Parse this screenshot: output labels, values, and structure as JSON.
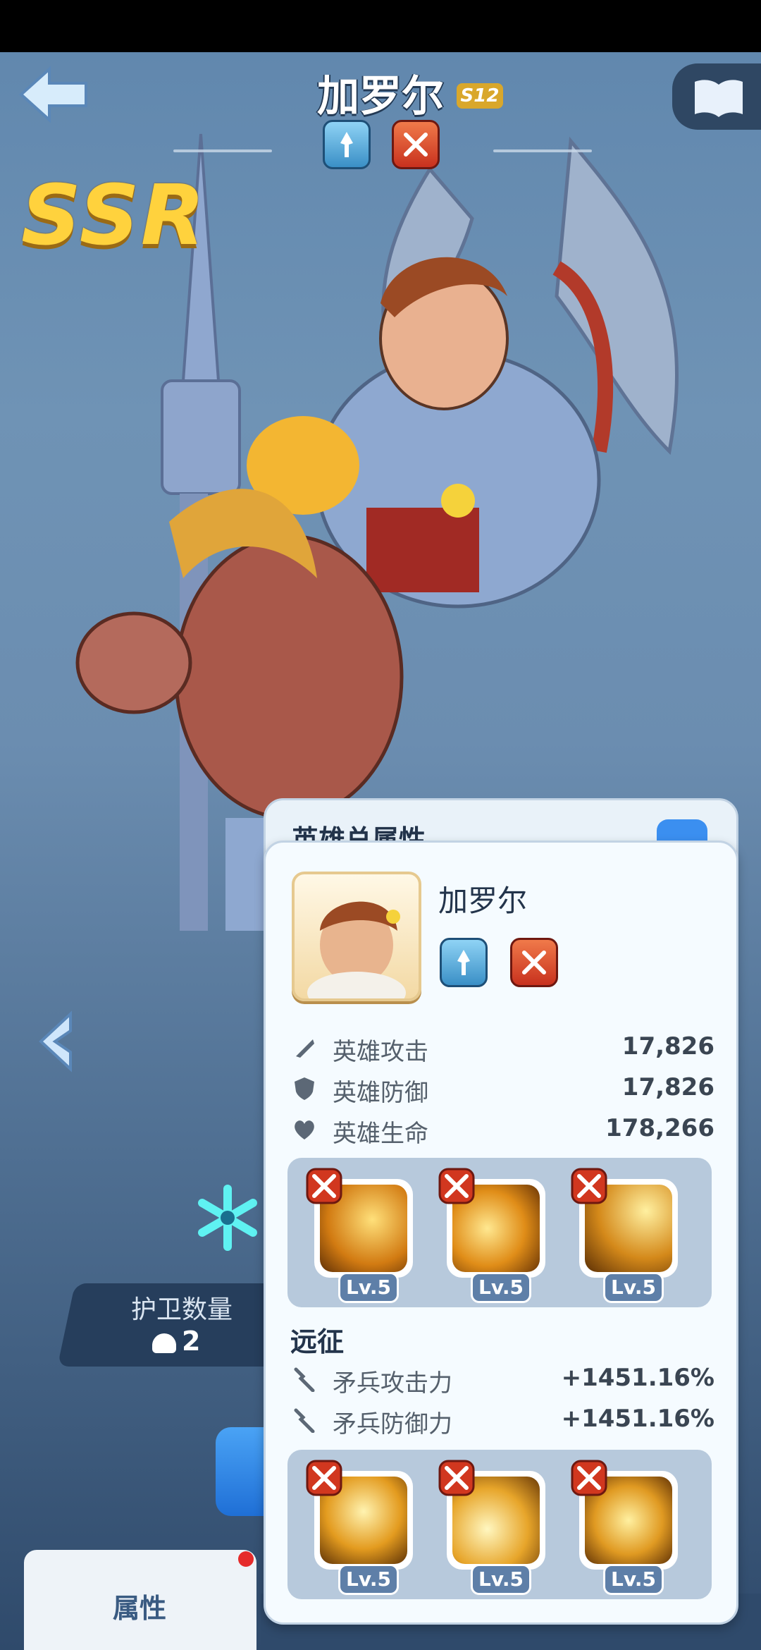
{
  "header": {
    "title": "加罗尔",
    "star_badge": "S12",
    "rarity": "SSR",
    "class_icons": [
      "spear-class-icon",
      "crossed-swords-icon"
    ]
  },
  "guard": {
    "label": "护卫数量",
    "count": "2"
  },
  "bottom_tabs": [
    {
      "label": "属性",
      "active": true,
      "has_notification": true
    }
  ],
  "panel": {
    "back_title": "英雄总属性",
    "hero_name": "加罗尔",
    "stats": [
      {
        "icon": "sword-icon",
        "label": "英雄攻击",
        "value": "17,826"
      },
      {
        "icon": "shield-icon",
        "label": "英雄防御",
        "value": "17,826"
      },
      {
        "icon": "heart-icon",
        "label": "英雄生命",
        "value": "178,266"
      }
    ],
    "skills_top": [
      {
        "level": "Lv.5"
      },
      {
        "level": "Lv.5"
      },
      {
        "level": "Lv.5"
      }
    ],
    "expedition": {
      "title": "远征",
      "stats": [
        {
          "icon": "spear-icon",
          "label": "矛兵攻击力",
          "value": "+1451.16%"
        },
        {
          "icon": "spear-icon",
          "label": "矛兵防御力",
          "value": "+1451.16%"
        }
      ]
    },
    "skills_bottom": [
      {
        "level": "Lv.5"
      },
      {
        "level": "Lv.5"
      },
      {
        "level": "Lv.5"
      }
    ]
  },
  "colors": {
    "accent_blue": "#3b8ff0",
    "rarity_gold": "#ffd23d",
    "class_red": "#c8311e",
    "class_blue": "#3a8fc6"
  }
}
